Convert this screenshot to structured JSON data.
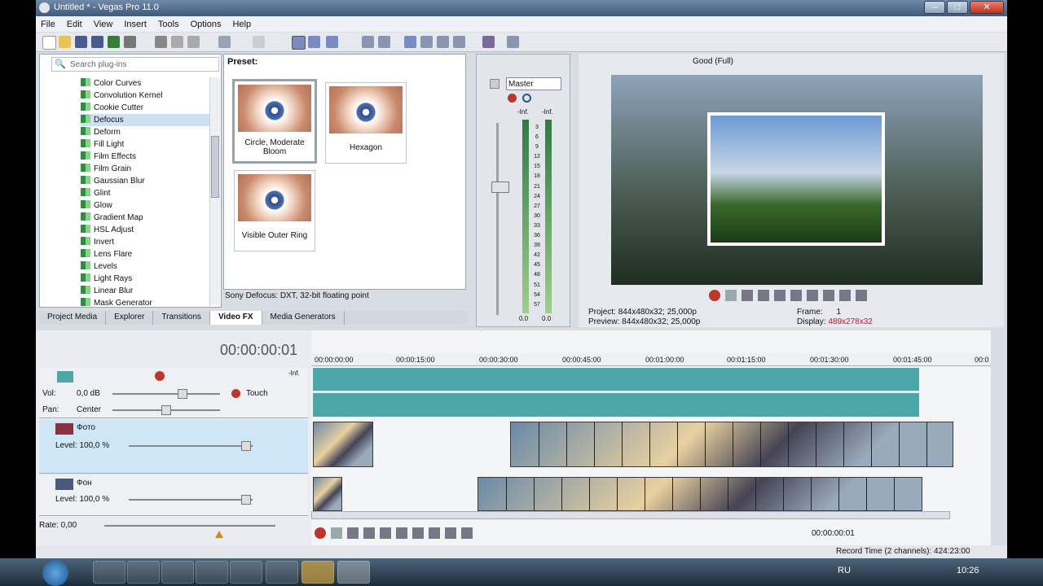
{
  "window": {
    "title": "Untitled * - Vegas Pro 11.0",
    "min": "–",
    "max": "□",
    "close": "✕"
  },
  "menu": [
    "File",
    "Edit",
    "View",
    "Insert",
    "Tools",
    "Options",
    "Help"
  ],
  "explorer": {
    "search_placeholder": "Search plug-ins",
    "plugins": [
      "Color Curves",
      "Convolution Kernel",
      "Cookie Cutter",
      "Defocus",
      "Deform",
      "Fill Light",
      "Film Effects",
      "Film Grain",
      "Gaussian Blur",
      "Glint",
      "Glow",
      "Gradient Map",
      "HSL Adjust",
      "Invert",
      "Lens Flare",
      "Levels",
      "Light Rays",
      "Linear Blur",
      "Mask Generator"
    ],
    "preset_label": "Preset:",
    "presets": [
      "Circle, Moderate Bloom",
      "Hexagon",
      "Visible Outer Ring"
    ],
    "status": "Sony Defocus: DXT, 32-bit floating point",
    "tabs": [
      "Project Media",
      "Explorer",
      "Transitions",
      "Video FX",
      "Media Generators"
    ],
    "active_tab": "Video FX"
  },
  "mixer": {
    "master_label": "Master",
    "inf_left": "-Inf.",
    "inf_right": "-Inf.",
    "scale": [
      "3",
      "6",
      "9",
      "12",
      "15",
      "18",
      "21",
      "24",
      "27",
      "30",
      "33",
      "36",
      "39",
      "42",
      "45",
      "48",
      "51",
      "54",
      "57"
    ],
    "readout_left": "0.0",
    "readout_right": "0.0"
  },
  "preview": {
    "quality": "Good (Full)",
    "project_label": "Project:",
    "project_value": "844x480x32; 25,000p",
    "preview_label": "Preview:",
    "preview_value": "844x480x32; 25,000p",
    "frame_label": "Frame:",
    "frame_value": "1",
    "display_label": "Display:",
    "display_value": "489x278x32"
  },
  "timeline": {
    "timecode": "00:00:00:01",
    "ruler": [
      "00:00:00:00",
      "00:00:15:00",
      "00:00:30:00",
      "00:00:45:00",
      "00:01:00:00",
      "00:01:15:00",
      "00:01:30:00",
      "00:01:45:00",
      "00:0"
    ],
    "audio": {
      "vol_label": "Vol:",
      "vol_value": "0,0 dB",
      "pan_label": "Pan:",
      "pan_value": "Center",
      "mode": "Touch",
      "inf": "-Inf."
    },
    "track1": {
      "name": "Фото",
      "level": "Level: 100,0 %"
    },
    "track2": {
      "name": "Фон",
      "level": "Level: 100,0 %"
    },
    "rate": "Rate: 0,00",
    "bottom_timecode": "00:00:00:01",
    "record_time": "Record Time (2 channels): 424:23:00"
  },
  "taskbar": {
    "lang": "RU",
    "clock": "10:26"
  },
  "colors": {
    "accent": "#4ba7a8",
    "display_value": "#c0182c"
  }
}
